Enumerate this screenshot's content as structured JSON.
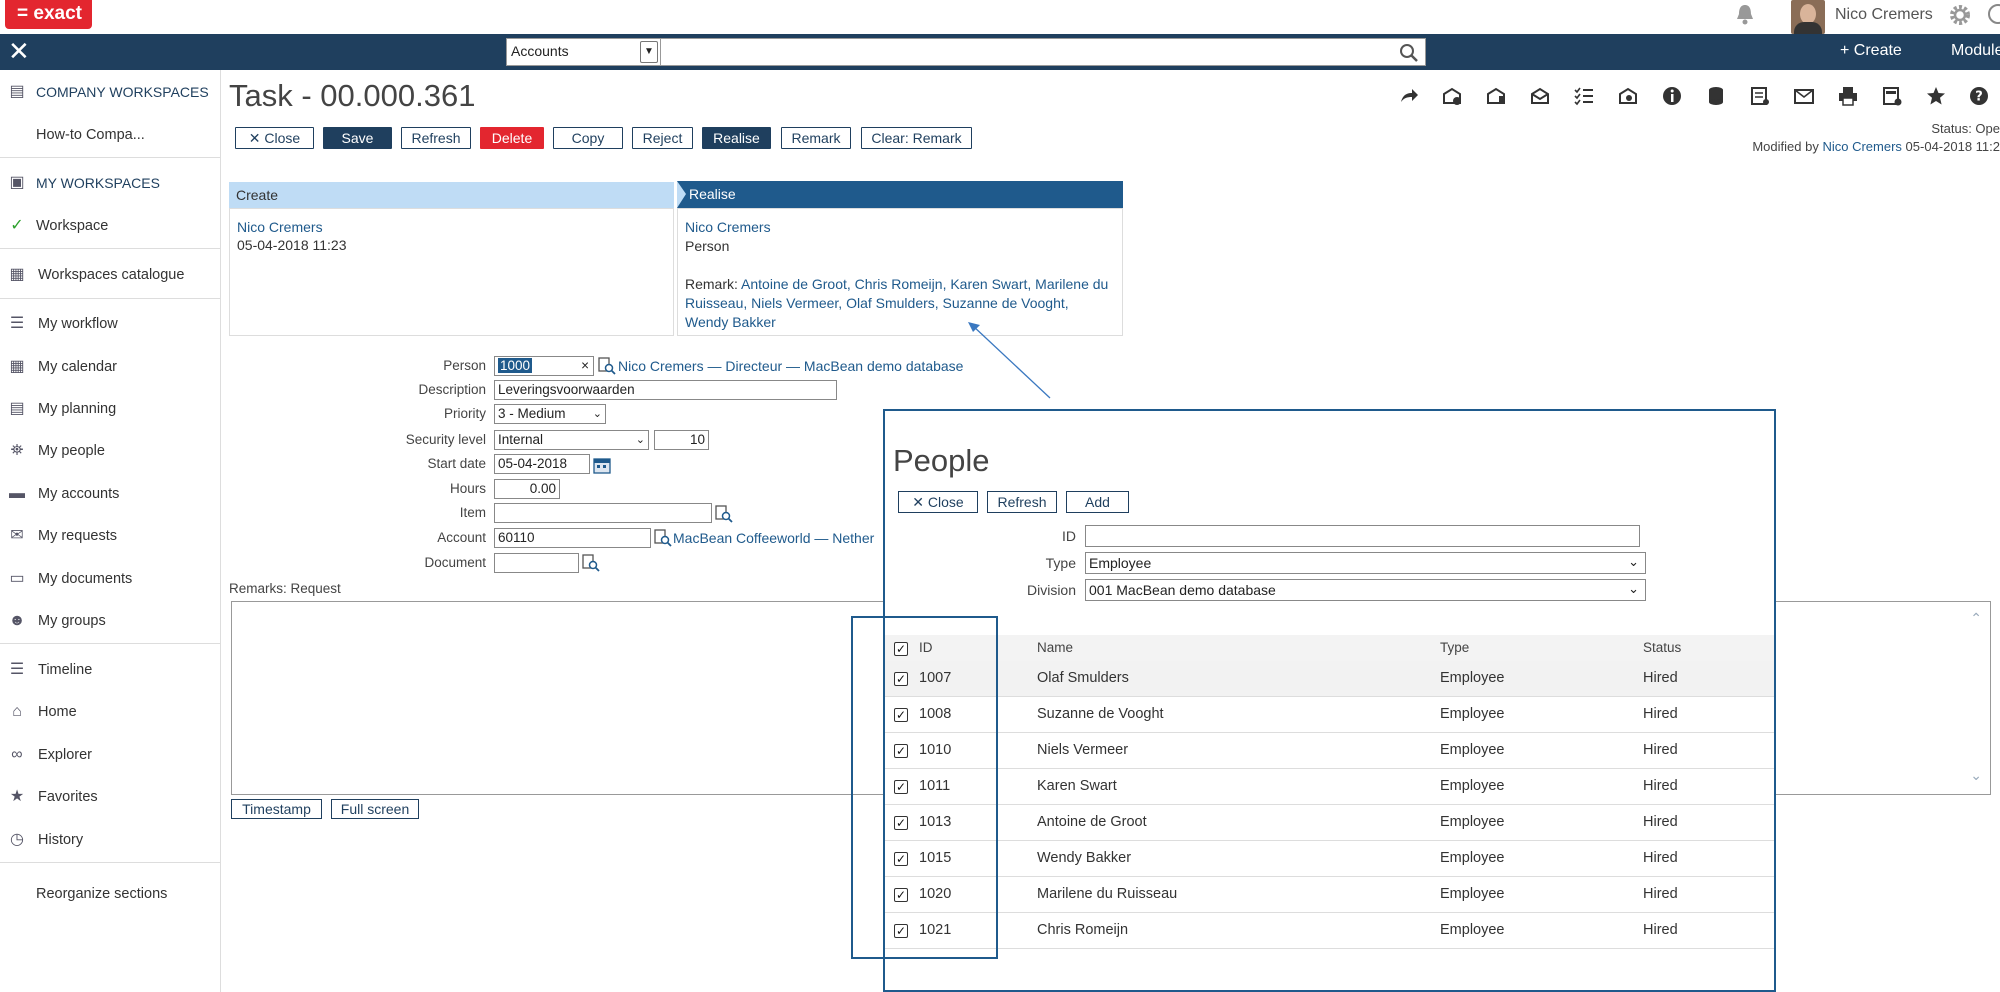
{
  "topbar": {
    "logo": "= exact",
    "user_name": "Nico Cremers"
  },
  "navbar": {
    "search_scope": "Accounts",
    "search_value": "",
    "create_label": "+ Create",
    "modules_label": "Module"
  },
  "sidebar": {
    "items": [
      {
        "label": "COMPANY WORKSPACES",
        "icon": "workspace-icon"
      },
      {
        "label": "How-to Compa..."
      },
      {
        "label": "MY WORKSPACES",
        "icon": "workspace-icon"
      },
      {
        "label": "Workspace",
        "icon": "check-icon"
      },
      {
        "label": "Workspaces catalogue",
        "icon": "grid-icon"
      },
      {
        "label": "My workflow",
        "icon": "checklist-icon"
      },
      {
        "label": "My calendar",
        "icon": "calendar-icon"
      },
      {
        "label": "My planning",
        "icon": "planning-icon"
      },
      {
        "label": "My people",
        "icon": "people-icon"
      },
      {
        "label": "My accounts",
        "icon": "card-icon"
      },
      {
        "label": "My requests",
        "icon": "mail-icon"
      },
      {
        "label": "My documents",
        "icon": "document-icon"
      },
      {
        "label": "My groups",
        "icon": "group-icon"
      },
      {
        "label": "Timeline",
        "icon": "timeline-icon"
      },
      {
        "label": "Home",
        "icon": "home-icon"
      },
      {
        "label": "Explorer",
        "icon": "binoculars-icon"
      },
      {
        "label": "Favorites",
        "icon": "star-icon"
      },
      {
        "label": "History",
        "icon": "clock-icon"
      },
      {
        "label": "Reorganize sections"
      }
    ]
  },
  "task": {
    "title": "Task - 00.000.361",
    "buttons": {
      "close": "Close",
      "save": "Save",
      "refresh": "Refresh",
      "delete": "Delete",
      "copy": "Copy",
      "reject": "Reject",
      "realise": "Realise",
      "remark": "Remark",
      "clear_remark": "Clear: Remark"
    },
    "status_label": "Status: Ope",
    "modified_prefix": "Modified by",
    "modified_by": "Nico Cremers",
    "modified_date": "05-04-2018 11:2"
  },
  "workflow": {
    "create": {
      "header": "Create",
      "person": "Nico Cremers",
      "date": "05-04-2018 11:23"
    },
    "realise": {
      "header": "Realise",
      "person": "Nico Cremers",
      "role": "Person",
      "remark_label": "Remark:",
      "remark_people": "Antoine de Groot, Chris Romeijn, Karen Swart, Marilene du Ruisseau, Niels Vermeer, Olaf Smulders, Suzanne de Vooght, Wendy Bakker"
    }
  },
  "form": {
    "person_label": "Person",
    "person_value": "1000",
    "person_link": "Nico Cremers — Directeur — MacBean demo database",
    "description_label": "Description",
    "description_value": "Leveringsvoorwaarden",
    "priority_label": "Priority",
    "priority_value": "3 - Medium",
    "security_label": "Security level",
    "security_value": "Internal",
    "security_number": "10",
    "start_date_label": "Start date",
    "start_date_value": "05-04-2018",
    "hours_label": "Hours",
    "hours_value": "0.00",
    "item_label": "Item",
    "item_value": "",
    "account_label": "Account",
    "account_value": "60110",
    "account_link": "MacBean Coffeeworld — Nether",
    "document_label": "Document",
    "document_value": "",
    "remarks_label": "Remarks: Request",
    "timestamp_button": "Timestamp",
    "fullscreen_button": "Full screen"
  },
  "people_dialog": {
    "title": "People",
    "buttons": {
      "close": "Close",
      "refresh": "Refresh",
      "add": "Add"
    },
    "id_label": "ID",
    "id_value": "",
    "type_label": "Type",
    "type_value": "Employee",
    "division_label": "Division",
    "division_value": "001 MacBean demo database",
    "columns": {
      "id": "ID",
      "name": "Name",
      "type": "Type",
      "status": "Status"
    },
    "rows": [
      {
        "id": "1007",
        "name": "Olaf Smulders",
        "type": "Employee",
        "status": "Hired"
      },
      {
        "id": "1008",
        "name": "Suzanne de Vooght",
        "type": "Employee",
        "status": "Hired"
      },
      {
        "id": "1010",
        "name": "Niels Vermeer",
        "type": "Employee",
        "status": "Hired"
      },
      {
        "id": "1011",
        "name": "Karen Swart",
        "type": "Employee",
        "status": "Hired"
      },
      {
        "id": "1013",
        "name": "Antoine de Groot",
        "type": "Employee",
        "status": "Hired"
      },
      {
        "id": "1015",
        "name": "Wendy Bakker",
        "type": "Employee",
        "status": "Hired"
      },
      {
        "id": "1020",
        "name": "Marilene du Ruisseau",
        "type": "Employee",
        "status": "Hired"
      },
      {
        "id": "1021",
        "name": "Chris Romeijn",
        "type": "Employee",
        "status": "Hired"
      }
    ]
  },
  "colors": {
    "brand_red": "#e3262f",
    "nav_blue": "#1f3f5e",
    "link_blue": "#1f5a8c",
    "create_header": "#bfdcf5"
  }
}
